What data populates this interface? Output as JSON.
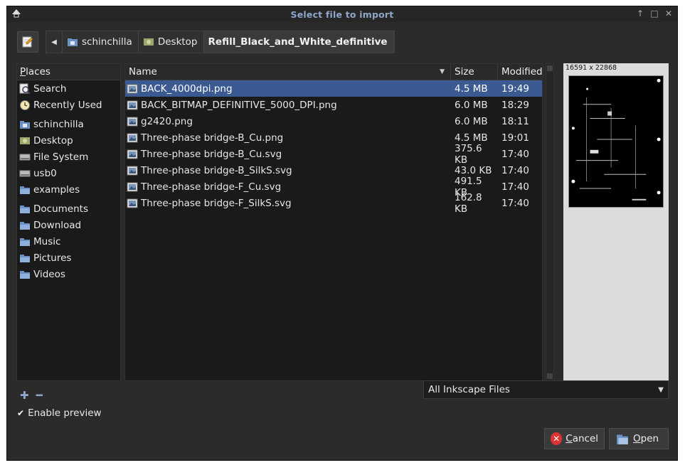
{
  "window": {
    "title": "Select file to import"
  },
  "titlebar_buttons": {
    "up": "↑",
    "max": "□",
    "close": "✕"
  },
  "path": {
    "crumbs": [
      "schinchilla",
      "Desktop",
      "Refill_Black_and_White_definitive"
    ]
  },
  "places": {
    "header": "Places",
    "header_underline": "P",
    "items": [
      {
        "label": "Search",
        "icon": "search-icon"
      },
      {
        "label": "Recently Used",
        "icon": "clock-icon"
      },
      {
        "label": "schinchilla",
        "icon": "home-folder-icon"
      },
      {
        "label": "Desktop",
        "icon": "desktop-icon"
      },
      {
        "label": "File System",
        "icon": "drive-icon"
      },
      {
        "label": "usb0",
        "icon": "drive-icon"
      },
      {
        "label": "examples",
        "icon": "folder-icon"
      },
      {
        "label": "Documents",
        "icon": "folder-icon"
      },
      {
        "label": "Download",
        "icon": "folder-icon"
      },
      {
        "label": "Music",
        "icon": "folder-icon"
      },
      {
        "label": "Pictures",
        "icon": "folder-icon"
      },
      {
        "label": "Videos",
        "icon": "folder-icon"
      }
    ]
  },
  "columns": {
    "name": "Name",
    "size": "Size",
    "modified": "Modified"
  },
  "files": [
    {
      "name": "BACK_4000dpi.png",
      "size": "4.5 MB",
      "modified": "19:49",
      "selected": true
    },
    {
      "name": "BACK_BITMAP_DEFINITIVE_5000_DPI.png",
      "size": "6.0 MB",
      "modified": "18:29"
    },
    {
      "name": "g2420.png",
      "size": "6.0 MB",
      "modified": "18:11"
    },
    {
      "name": "Three-phase bridge-B_Cu.png",
      "size": "4.5 MB",
      "modified": "19:01"
    },
    {
      "name": "Three-phase bridge-B_Cu.svg",
      "size": "375.6 KB",
      "modified": "17:40"
    },
    {
      "name": "Three-phase bridge-B_SilkS.svg",
      "size": "43.0 KB",
      "modified": "17:40"
    },
    {
      "name": "Three-phase bridge-F_Cu.svg",
      "size": "491.5 KB",
      "modified": "17:40"
    },
    {
      "name": "Three-phase bridge-F_SilkS.svg",
      "size": "162.8 KB",
      "modified": "17:40"
    }
  ],
  "preview": {
    "dimensions": "16591 x 22868"
  },
  "filter": {
    "selected": "All Inkscape Files"
  },
  "enable_preview": {
    "label": "Enable preview",
    "checked": true
  },
  "buttons": {
    "cancel_label_rest": "ancel",
    "cancel_mnemonic": "C",
    "open_label_rest": "pen",
    "open_mnemonic": "O"
  },
  "colors": {
    "selection": "#3c5a92",
    "accent": "#8ea6c8"
  }
}
